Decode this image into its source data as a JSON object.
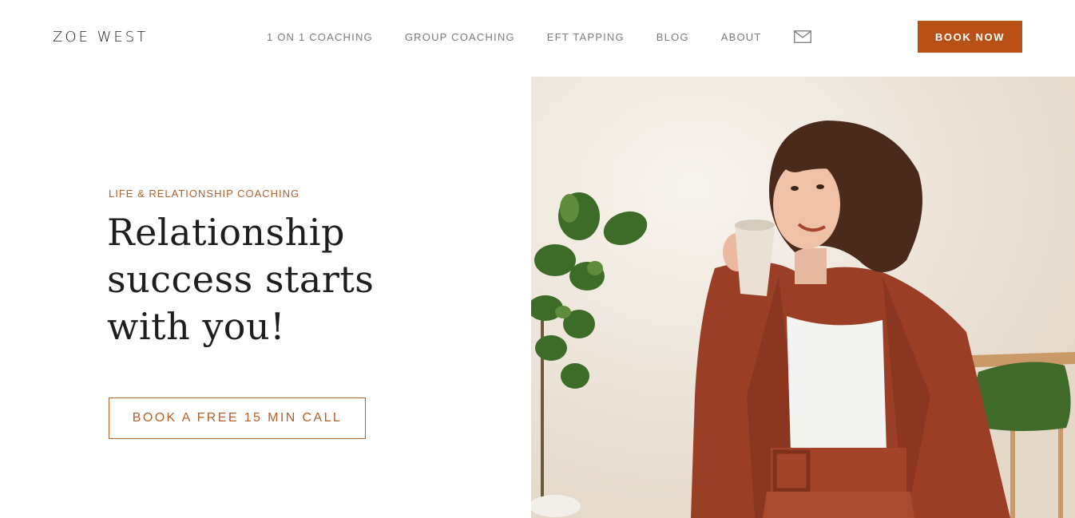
{
  "header": {
    "logo": "ZOE WEST",
    "nav": [
      {
        "label": "1 ON 1 COACHING"
      },
      {
        "label": "GROUP COACHING"
      },
      {
        "label": "EFT TAPPING"
      },
      {
        "label": "BLOG"
      },
      {
        "label": "ABOUT"
      }
    ],
    "mail_icon": "mail-icon",
    "book_now_label": "BOOK NOW"
  },
  "hero": {
    "eyebrow": "LIFE & RELATIONSHIP COACHING",
    "headline": "Relationship success starts with you!",
    "cta_label": "BOOK A FREE 15 MIN CALL"
  },
  "colors": {
    "accent": "#b95116",
    "accent_text": "#b3602c",
    "text_dark": "#1e1e1e",
    "nav_gray": "#7a7a7a"
  }
}
